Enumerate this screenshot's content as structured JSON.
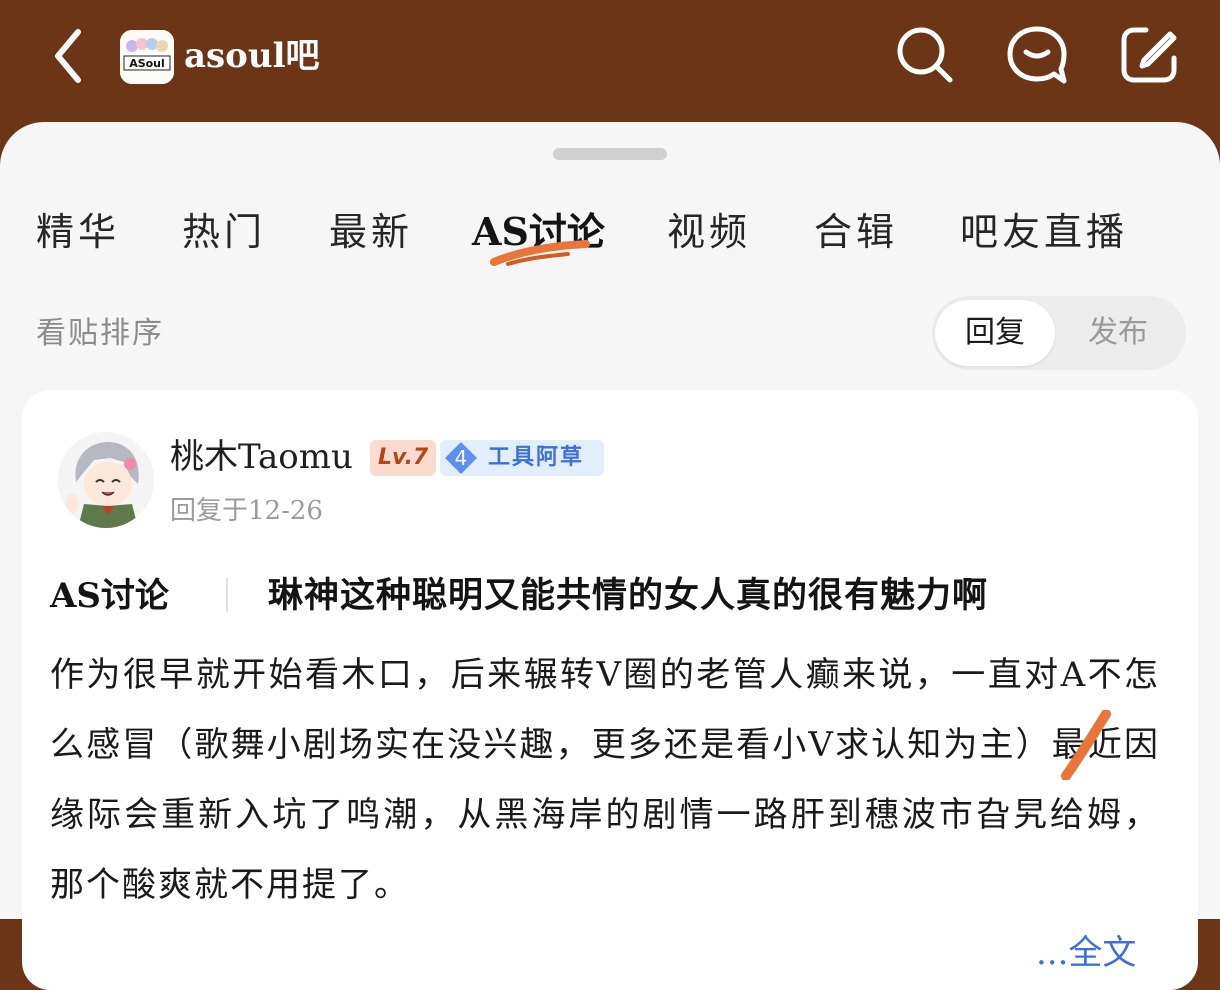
{
  "header": {
    "back_label": "back",
    "forum_name": "asoul吧",
    "logo_text": "ASoul"
  },
  "tabs": [
    {
      "label": "精华",
      "active": false
    },
    {
      "label": "热门",
      "active": false
    },
    {
      "label": "最新",
      "active": false
    },
    {
      "label": "AS讨论",
      "active": true
    },
    {
      "label": "视频",
      "active": false
    },
    {
      "label": "合辑",
      "active": false
    },
    {
      "label": "吧友直播",
      "active": false
    }
  ],
  "sort": {
    "label": "看贴排序",
    "options": [
      {
        "label": "回复",
        "selected": true
      },
      {
        "label": "发布",
        "selected": false
      }
    ]
  },
  "post": {
    "author": "桃木Taomu",
    "level": "Lv.7",
    "tool_level": "4",
    "tool_title": "工具阿草",
    "reply_time": "回复于12-26",
    "tag": "AS讨论",
    "title": "琳神这种聪明又能共情的女人真的很有魅力啊",
    "body": "作为很早就开始看木口，后来辗转V圈的老管人癫来说，一直对A不怎么感冒（歌舞小剧场实在没兴趣，更多还是看小V求认知为主）最近因缘际会重新入坑了鸣潮，从黑海岸的剧情一路肝到穗波市旮旯给姆，那个酸爽就不用提了。",
    "more_label": "...全文"
  },
  "colors": {
    "header_bg": "#6b3516",
    "accent_orange": "#e8753a",
    "link_blue": "#3d6fd6",
    "level_bg": "#fbdbd0",
    "level_text": "#b5451b"
  },
  "icons": [
    "back-icon",
    "search-icon",
    "message-icon",
    "edit-icon"
  ]
}
